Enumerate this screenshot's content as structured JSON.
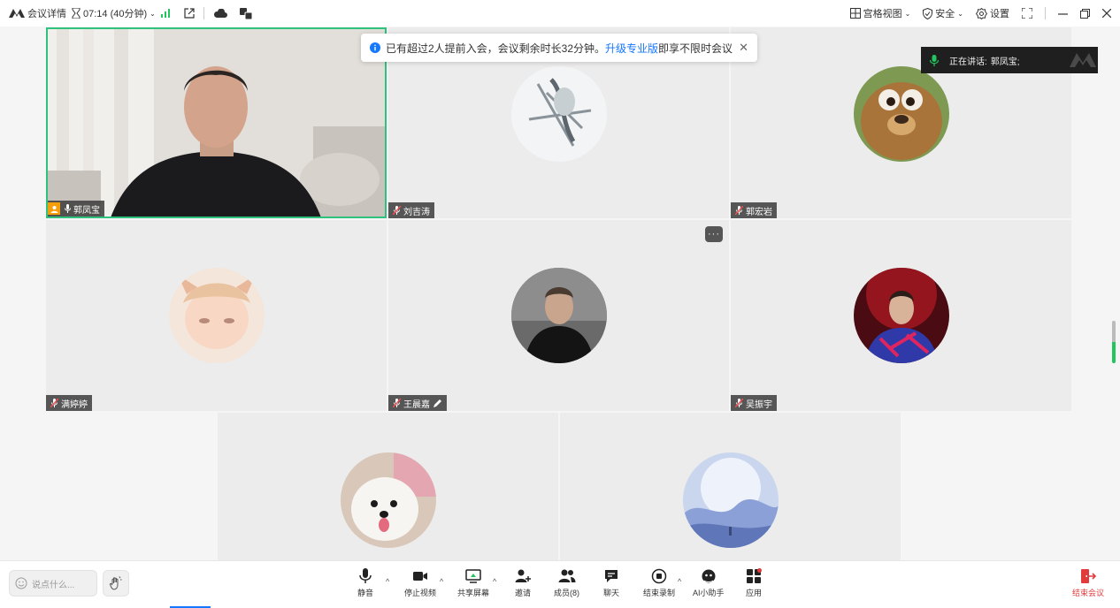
{
  "topbar": {
    "meeting_details": "会议详情",
    "timer": "07:14 (40分钟)",
    "right": {
      "gallery_view": "宫格视图",
      "security": "安全",
      "settings": "设置"
    }
  },
  "notice": {
    "text": "已有超过2人提前入会，会议剩余时长32分钟。",
    "link": "升级专业版",
    "after": "即享不限时会议"
  },
  "speaking": {
    "label": "正在讲话:",
    "name": "郭凤宝;"
  },
  "participants": [
    {
      "name": "郭凤宝"
    },
    {
      "name": "刘吉涛"
    },
    {
      "name": "郭宏岩"
    },
    {
      "name": "满婷婷"
    },
    {
      "name": "王晨嘉"
    },
    {
      "name": "吴振宇"
    }
  ],
  "bottombar": {
    "chat_placeholder": "说点什么...",
    "tools": {
      "mute": "静音",
      "stop_video": "停止视频",
      "share_screen": "共享屏幕",
      "invite": "邀请",
      "members": "成员(8)",
      "chat": "聊天",
      "end_recording": "结束录制",
      "ai_assistant": "AI小助手",
      "apps": "应用"
    },
    "end_meeting": "结束会议"
  },
  "colors": {
    "accent_green": "#2ec27e",
    "link_blue": "#1677ff",
    "end_red": "#e23b3b"
  }
}
